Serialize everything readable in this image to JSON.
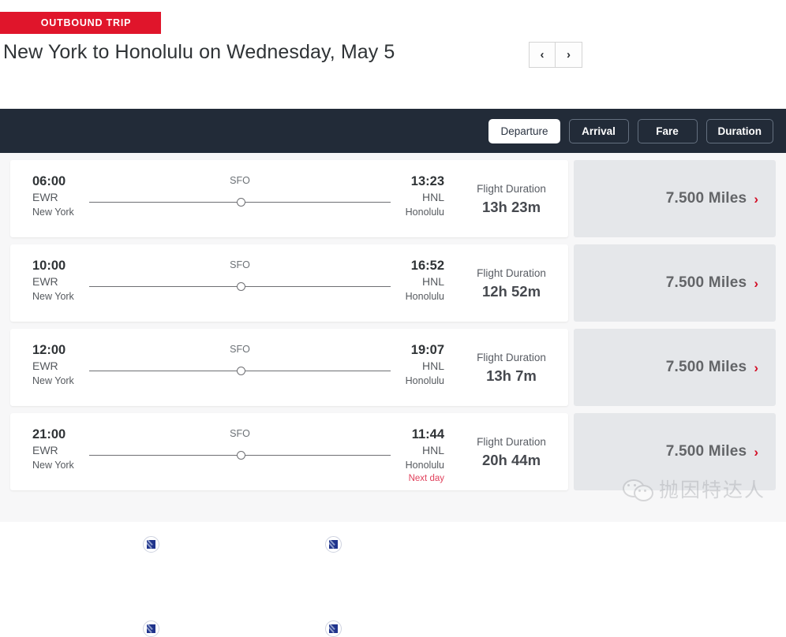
{
  "header": {
    "badge": "OUTBOUND TRIP",
    "title": "New York to Honolulu on Wednesday, May 5",
    "prev_icon": "‹",
    "next_icon": "›"
  },
  "sort_bar": {
    "buttons": [
      {
        "label": "Departure",
        "active": true
      },
      {
        "label": "Arrival",
        "active": false
      },
      {
        "label": "Fare",
        "active": false
      },
      {
        "label": "Duration",
        "active": false
      }
    ]
  },
  "flights": [
    {
      "depart_time": "06:00",
      "depart_code": "EWR",
      "depart_city": "New York",
      "stop_code": "SFO",
      "arrive_time": "13:23",
      "arrive_code": "HNL",
      "arrive_city": "Honolulu",
      "next_day": "",
      "duration_label": "Flight Duration",
      "duration_value": "13h 23m",
      "price": "7.500 Miles",
      "price_chevron": "›"
    },
    {
      "depart_time": "10:00",
      "depart_code": "EWR",
      "depart_city": "New York",
      "stop_code": "SFO",
      "arrive_time": "16:52",
      "arrive_code": "HNL",
      "arrive_city": "Honolulu",
      "next_day": "",
      "duration_label": "Flight Duration",
      "duration_value": "12h 52m",
      "price": "7.500 Miles",
      "price_chevron": "›"
    },
    {
      "depart_time": "12:00",
      "depart_code": "EWR",
      "depart_city": "New York",
      "stop_code": "SFO",
      "arrive_time": "19:07",
      "arrive_code": "HNL",
      "arrive_city": "Honolulu",
      "next_day": "",
      "duration_label": "Flight Duration",
      "duration_value": "13h 7m",
      "price": "7.500 Miles",
      "price_chevron": "›"
    },
    {
      "depart_time": "21:00",
      "depart_code": "EWR",
      "depart_city": "New York",
      "stop_code": "SFO",
      "arrive_time": "11:44",
      "arrive_code": "HNL",
      "arrive_city": "Honolulu",
      "next_day": "Next day",
      "duration_label": "Flight Duration",
      "duration_value": "20h 44m",
      "price": "7.500 Miles",
      "price_chevron": "›"
    }
  ],
  "watermark": {
    "text": "抛因特达人",
    "icon": "wechat-icon"
  },
  "colors": {
    "badge_red": "#e0152b",
    "sort_bar_navy": "#222b38",
    "price_panel_gray": "#e5e7ea",
    "chevron_red": "#d31027",
    "next_day_red": "#e0415c"
  }
}
